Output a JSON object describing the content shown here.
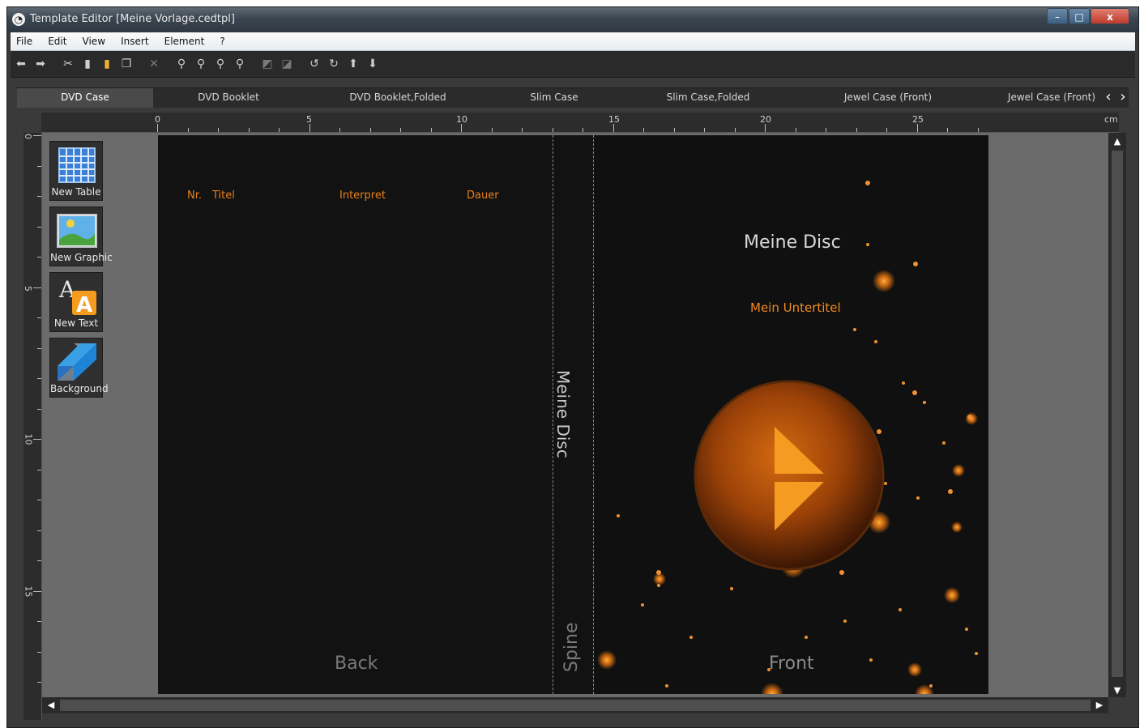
{
  "window": {
    "title": "Template Editor [Meine Vorlage.cedtpl]",
    "controls": {
      "minimize": "–",
      "maximize": "□",
      "close": "x"
    }
  },
  "menu": [
    "File",
    "Edit",
    "View",
    "Insert",
    "Element",
    "?"
  ],
  "toolbar_icons": [
    "back-icon",
    "forward-icon",
    "cut-icon",
    "copy-icon",
    "paste-icon",
    "duplicate-icon",
    "delete-icon",
    "zoom-fit-icon",
    "zoom-in-icon",
    "zoom-out-icon",
    "zoom-actual-icon",
    "flip-horizontal-icon",
    "flip-vertical-icon",
    "rotate-left-icon",
    "rotate-right-icon",
    "bring-forward-icon",
    "send-backward-icon"
  ],
  "tabs": [
    "DVD Case",
    "DVD Booklet",
    "DVD Booklet,Folded",
    "Slim Case",
    "Slim Case,Folded",
    "Jewel Case (Front)",
    "Jewel Case (Front)"
  ],
  "active_tab": "DVD Case",
  "ruler": {
    "top_labels": [
      "0",
      "5",
      "10",
      "15",
      "20",
      "25"
    ],
    "left_labels": [
      "0",
      "5",
      "10",
      "15"
    ],
    "unit": "cm"
  },
  "palette": [
    "New Table",
    "New Graphic",
    "New Text",
    "Background"
  ],
  "page": {
    "back_headers": [
      "Nr.",
      "Titel",
      "Interpret",
      "Dauer"
    ],
    "disc_title": "Meine Disc",
    "disc_subtitle": "Mein Untertitel",
    "spine_title": "Meine Disc",
    "spine_label": "Spine",
    "back_label": "Back",
    "front_label": "Front"
  },
  "colors": {
    "accent": "#f28a20",
    "page_bg": "#121212",
    "canvas_bg": "#6b6b6b"
  }
}
